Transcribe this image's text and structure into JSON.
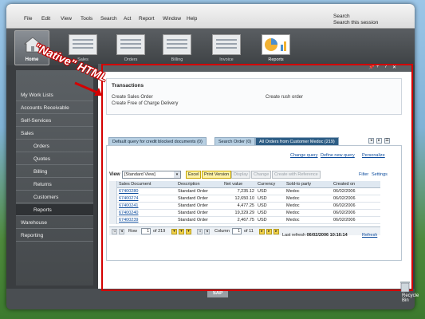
{
  "menu": [
    "File",
    "Edit",
    "View",
    "Tools",
    "Search",
    "Act",
    "Report",
    "Window",
    "Help"
  ],
  "search": {
    "line1": "Search",
    "line2": "Search this session"
  },
  "home_label": "Home",
  "launch_items": [
    {
      "label": "Sales"
    },
    {
      "label": "Orders"
    },
    {
      "label": "Billing"
    },
    {
      "label": "Invoice"
    },
    {
      "label": "Reports"
    }
  ],
  "nav": [
    {
      "label": "My Work Lists"
    },
    {
      "label": "Accounts Receivable"
    },
    {
      "label": "Self-Services"
    },
    {
      "label": "Sales"
    },
    {
      "label": "Orders"
    },
    {
      "label": "Quotes"
    },
    {
      "label": "Billing"
    },
    {
      "label": "Returns"
    },
    {
      "label": "Customers"
    },
    {
      "label": "Reports"
    },
    {
      "label": "Warehouse"
    },
    {
      "label": "Reporting"
    }
  ],
  "transactions": {
    "title": "Transactions",
    "links": [
      "Create Sales Order",
      "Create Free of Charge Delivery",
      "Create rush order"
    ]
  },
  "tabs": [
    {
      "label": "Default query for credit blocked documents (0)"
    },
    {
      "label": "Search Order (0)"
    },
    {
      "label": "All Orders from Customer Medoc (219)"
    }
  ],
  "query_links": [
    "Change query",
    "Define new query",
    "Personalize"
  ],
  "toolbar": {
    "view_label": "View",
    "view_value": "[Standard View]",
    "buttons": [
      "Excel",
      "Print Version",
      "Display",
      "Change",
      "Create with Reference"
    ],
    "filter": "Filter",
    "settings": "Settings"
  },
  "table": {
    "headers": [
      "Sales Document",
      "Description",
      "Net value",
      "Currency",
      "Sold-to party",
      "Created on"
    ],
    "rows": [
      [
        "67400280",
        "Standard Order",
        "7,235.12",
        "USD",
        "Medoc",
        "06/02/2006"
      ],
      [
        "67400274",
        "Standard Order",
        "12,650.10",
        "USD",
        "Medoc",
        "06/02/2006"
      ],
      [
        "67400241",
        "Standard Order",
        "4,477.25",
        "USD",
        "Medoc",
        "06/02/2006"
      ],
      [
        "67400240",
        "Standard Order",
        "19,329.29",
        "USD",
        "Medoc",
        "06/02/2006"
      ],
      [
        "67400239",
        "Standard Order",
        "2,467.75",
        "USD",
        "Medoc",
        "06/02/2006"
      ]
    ]
  },
  "pager": {
    "row_label": "Row",
    "row_value": "1",
    "row_total": "of 219",
    "col_label": "Column",
    "col_value": "1",
    "col_total": "of 11"
  },
  "last_refresh": {
    "label": "Last refresh",
    "value": "06/02/2006 10:16:14"
  },
  "refresh_label": "Refresh",
  "annotation": "\"Native\" HTML",
  "footer_logo": "SAP",
  "recycle_label": "Recycle Bin"
}
